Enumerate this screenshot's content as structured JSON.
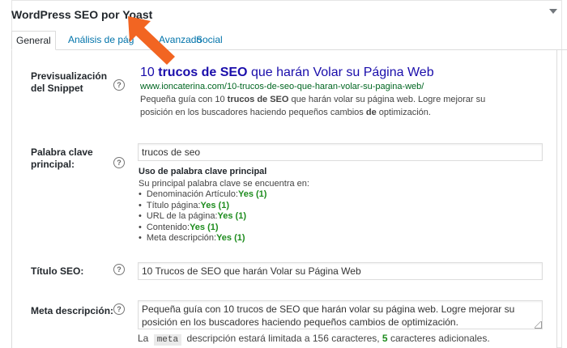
{
  "box": {
    "title": "WordPress SEO por Yoast"
  },
  "tabs": [
    {
      "label": "General"
    },
    {
      "label": "Análisis de pág"
    },
    {
      "label": "Avanzado"
    },
    {
      "label": "Social"
    }
  ],
  "snippet": {
    "label": "Previsualización del Snippet",
    "title_prefix": "10 ",
    "title_bold": "trucos de SEO",
    "title_rest": " que harán Volar su Página Web",
    "url": "www.ioncaterina.com/10-trucos-de-seo-que-haran-volar-su-pagina-web/",
    "desc_parts": [
      "Pequeña guía con 10 ",
      "trucos de SEO",
      " que harán volar su página web. Logre mejorar su posición en los buscadores haciendo pequeños cambios ",
      "de",
      " optimización."
    ]
  },
  "keyword": {
    "label": "Palabra clave principal:",
    "value": "trucos de seo",
    "usage_heading": "Uso de palabra clave principal",
    "usage_sub": "Su principal palabra clave se encuentra en:",
    "items": [
      {
        "label": "Denominación Artículo:",
        "result": "Yes (1)"
      },
      {
        "label": "Título página:",
        "result": "Yes (1)"
      },
      {
        "label": "URL de la página:",
        "result": "Yes (1)"
      },
      {
        "label": "Contenido:",
        "result": "Yes (1)"
      },
      {
        "label": "Meta descripción:",
        "result": "Yes (1)"
      }
    ]
  },
  "seo_title": {
    "label": "Título SEO:",
    "value": "10 Trucos de SEO que harán Volar su Página Web"
  },
  "meta": {
    "label": "Meta descripción:",
    "value": "Pequeña guía con 10 trucos de SEO que harán volar su página web. Logre mejorar su posición en los buscadores haciendo pequeños cambios de optimización.",
    "note_prefix": "La",
    "note_code": "meta",
    "note_mid": "descripción estará limitada a 156 caracteres,",
    "note_count": "5",
    "note_suffix": "caracteres adicionales."
  },
  "icons": {
    "help": "?",
    "help_icon": "question-circle-icon",
    "collapse_icon": "caret-down-icon",
    "annotation": "orange-arrow-icon"
  },
  "colors": {
    "link": "#0073aa",
    "snippet_title": "#1a0dab",
    "snippet_url": "#006621",
    "yes": "#1e8c1e",
    "arrow": "#f26522"
  }
}
